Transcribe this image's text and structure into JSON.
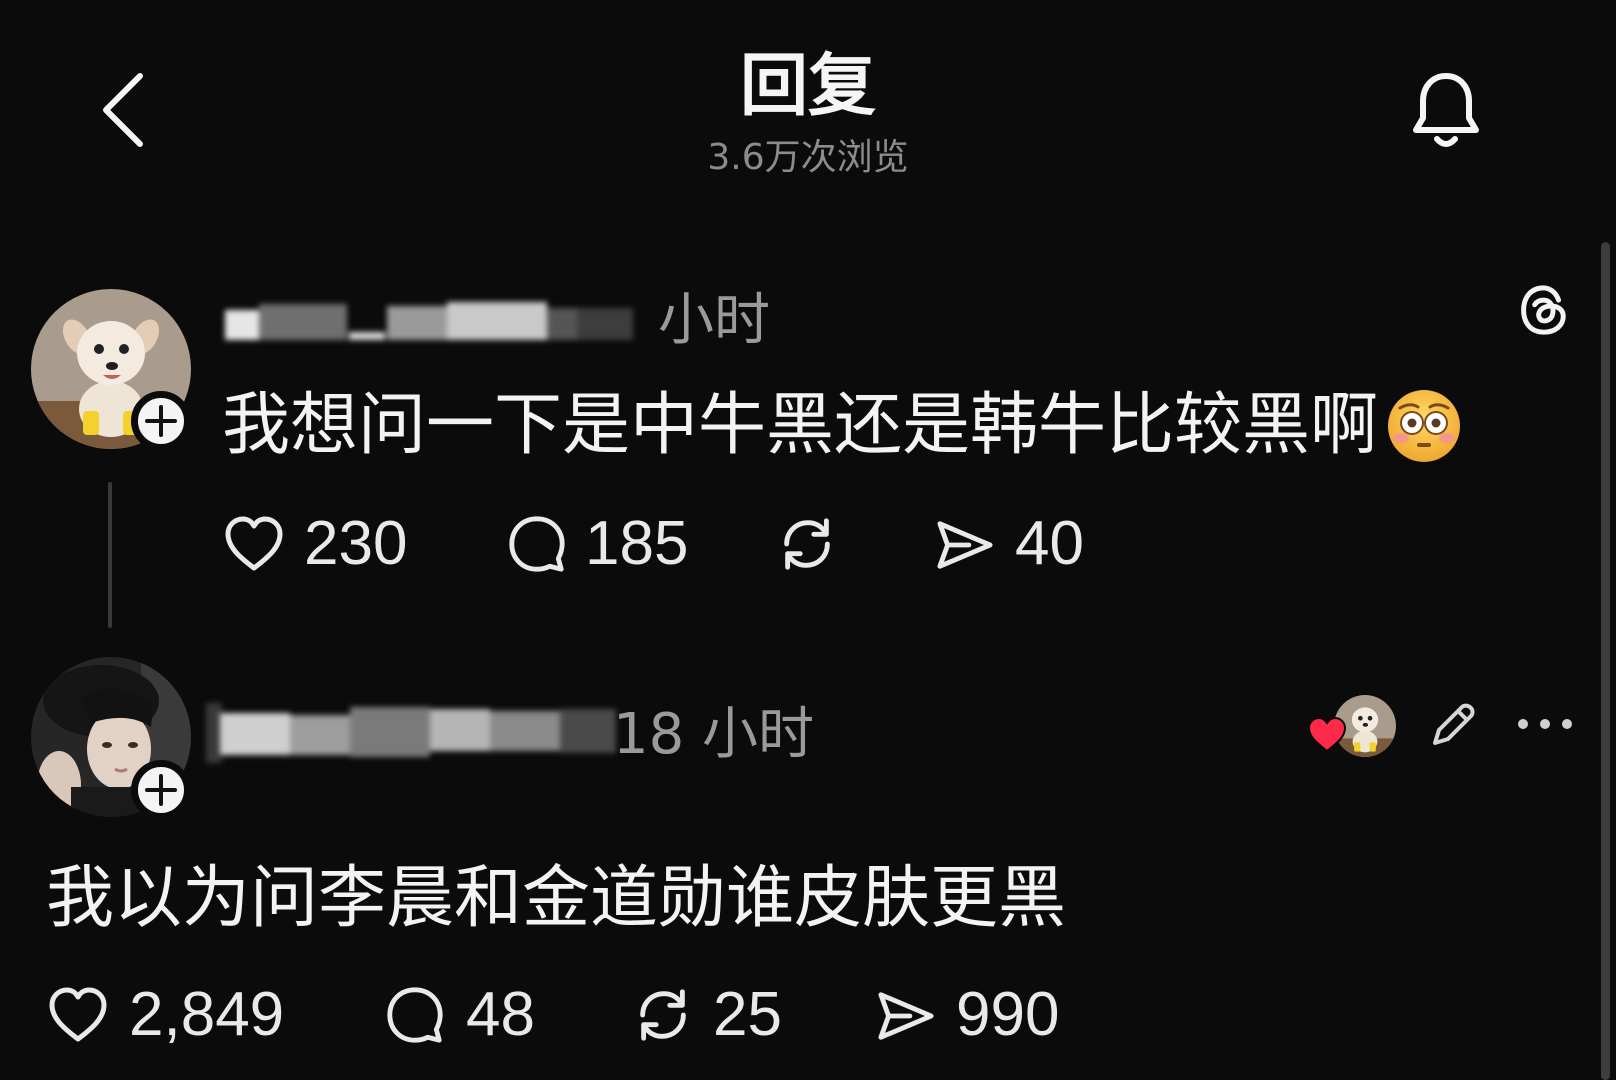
{
  "header": {
    "title": "回复",
    "subtitle": "3.6万次浏览"
  },
  "posts": [
    {
      "time": "小时",
      "text": "我想问一下是中牛黑还是韩牛比较黑啊",
      "emoji": "flushed-face-emoji",
      "stats": {
        "likes": "230",
        "replies": "185",
        "shares": "40"
      }
    },
    {
      "time": "18 小时",
      "text": "我以为问李晨和金道勋谁皮肤更黑",
      "stats": {
        "likes": "2,849",
        "replies": "48",
        "reposts": "25",
        "shares": "990"
      }
    }
  ],
  "icons": {
    "back": "chevron-left-icon",
    "notifications": "bell-icon",
    "app": "threads-logo-icon",
    "like": "heart-icon",
    "reply": "comment-bubble-icon",
    "repost": "repost-icon",
    "share": "send-icon",
    "edit": "pencil-icon",
    "more": "ellipsis-icon",
    "follow": "plus-icon"
  },
  "colors": {
    "background": "#0b0b0b",
    "text": "#f3f3f3",
    "muted": "#8c8c8c",
    "liked_heart": "#ff2a4a"
  }
}
